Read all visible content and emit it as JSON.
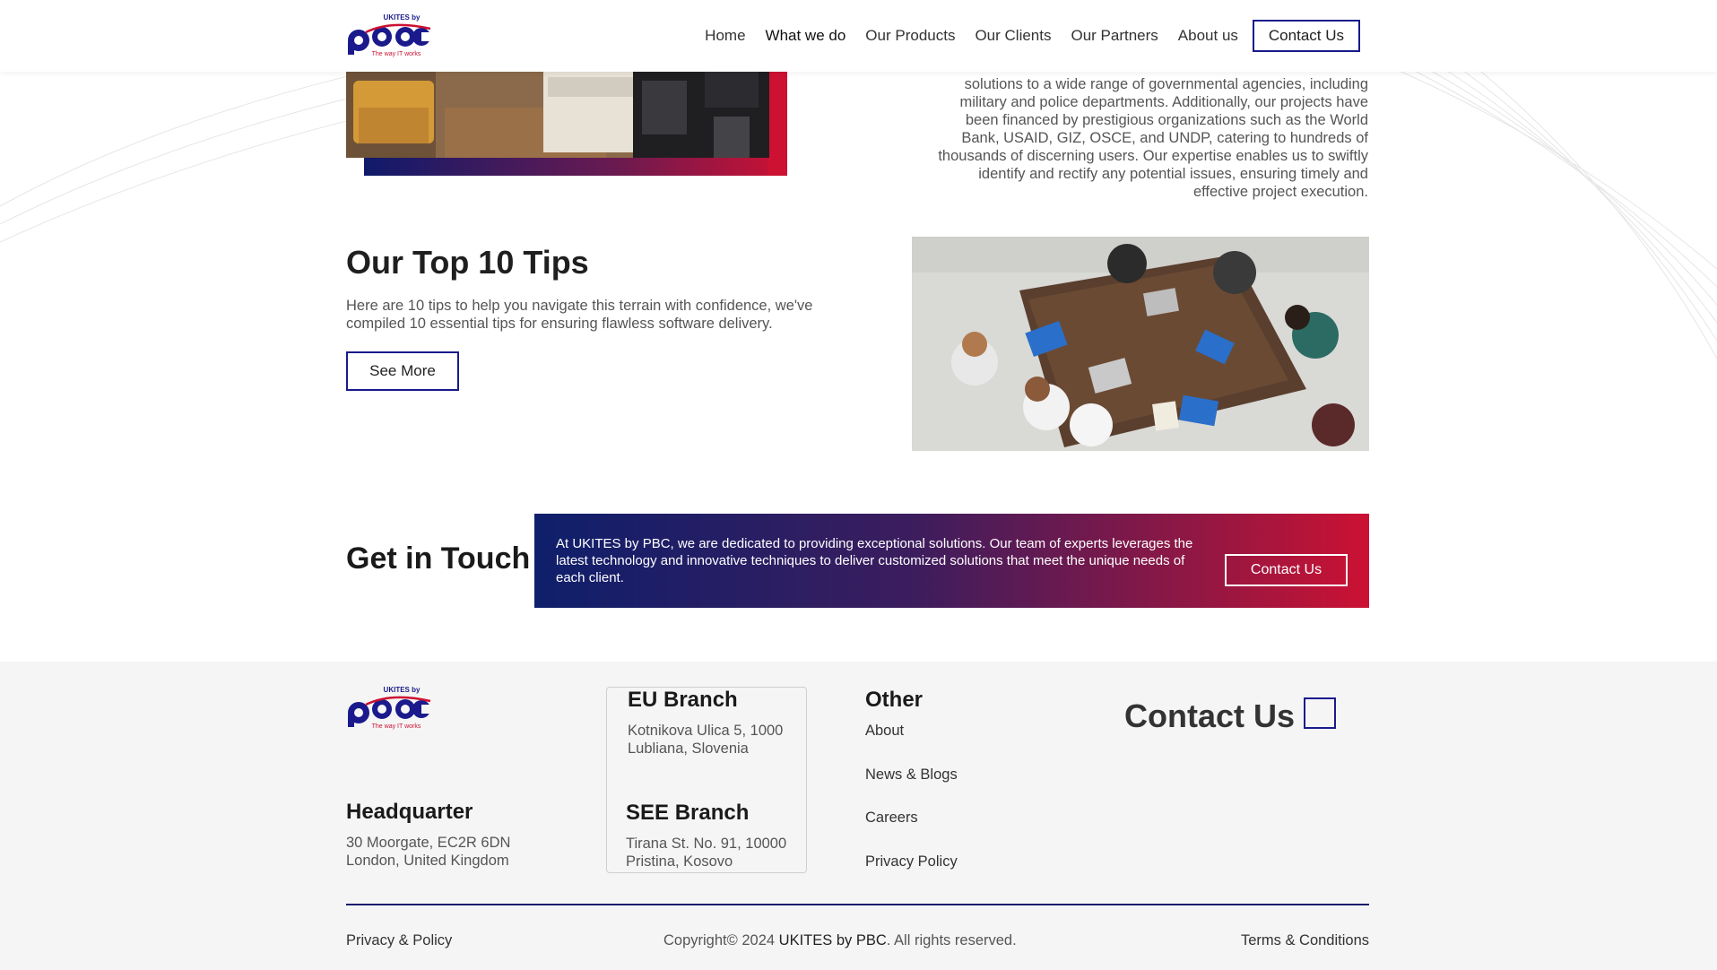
{
  "header": {
    "logo": {
      "top_text": "UKITES by",
      "main_text": "pbc",
      "tagline": "The way IT works"
    },
    "nav": [
      "Home",
      "What we do",
      "Our Products",
      "Our Clients",
      "Our Partners",
      "About us"
    ],
    "contact_label": "Contact Us"
  },
  "intro": {
    "text": "solutions to a wide range of governmental agencies, including military and police departments. Additionally, our projects have been financed by prestigious organizations such as the World Bank, USAID, GIZ, OSCE, and UNDP, catering to hundreds of thousands of discerning users. Our expertise enables us to swiftly identify and rectify any potential issues, ensuring timely and effective project execution."
  },
  "tips": {
    "title": "Our Top 10 Tips",
    "text": "Here are 10 tips to help you navigate this terrain with confidence, we've compiled 10 essential tips for ensuring flawless software delivery.",
    "button": "See More"
  },
  "get_in_touch": {
    "title": "Get in Touch",
    "text": "At UKITES by PBC, we are dedicated to providing exceptional solutions. Our team of experts leverages the latest technology and innovative techniques to deliver customized solutions that meet the unique needs of each client.",
    "button": "Contact Us"
  },
  "footer": {
    "hq": {
      "title": "Headquarter",
      "line1": "30 Moorgate, EC2R 6DN",
      "line2": "London, United Kingdom"
    },
    "eu": {
      "title": "EU Branch",
      "line1": "Kotnikova Ulica 5, 1000",
      "line2": "Lubliana, Slovenia"
    },
    "see": {
      "title": "SEE Branch",
      "line1": "Tirana St. No. 91, 10000",
      "line2": "Pristina, Kosovo"
    },
    "other": {
      "title": "Other",
      "links": [
        "About",
        "News & Blogs",
        "Careers",
        "Privacy Policy"
      ]
    },
    "contact_title": "Contact Us",
    "bottom": {
      "left": "Privacy & Policy",
      "copyright_prefix": "Copyright© 2024 ",
      "copyright_brand": "UKITES by PBC",
      "copyright_suffix": ". All rights reserved.",
      "right": "Terms & Conditions"
    }
  },
  "colors": {
    "brand_blue": "#1a1a8c",
    "brand_red": "#cc1133",
    "navy": "#0f1f6b",
    "footer_bg": "#f5f5f5"
  }
}
